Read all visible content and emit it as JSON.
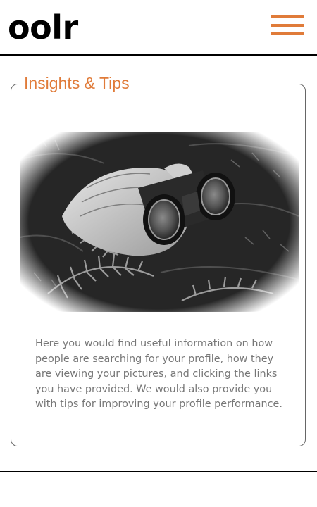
{
  "header": {
    "logo_text": "oolr",
    "menu_icon": "hamburger-menu-icon",
    "accent_color": "#e07b39"
  },
  "insights": {
    "title": "Insights & Tips",
    "image_icon": "binoculars-photo",
    "description": "Here you would find useful information on how people are searching for your profile, how they are viewing your pictures, and clicking the links you have provided. We would also provide you with tips for improving your profile performance."
  }
}
